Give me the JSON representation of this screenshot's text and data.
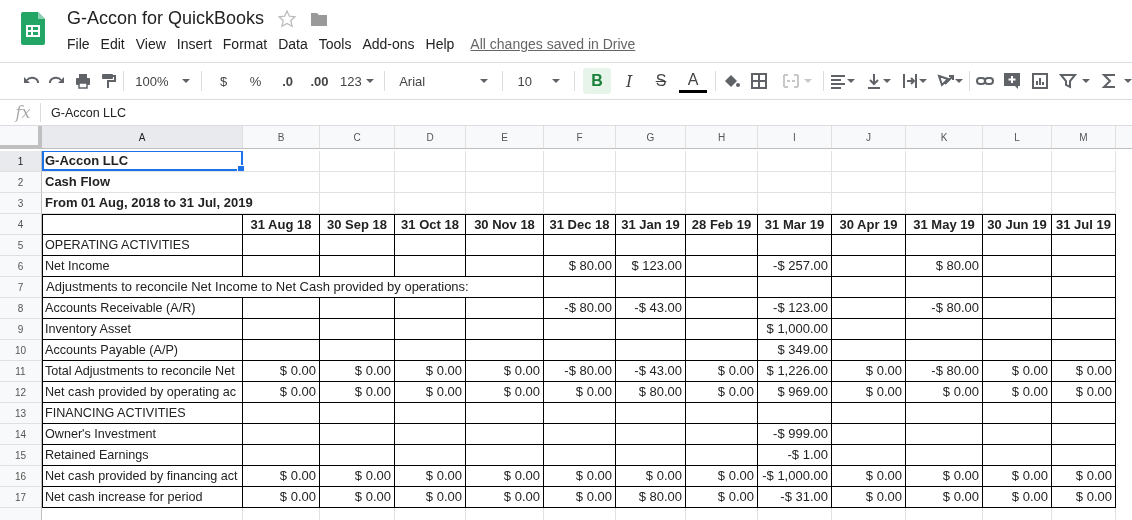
{
  "document": {
    "title": "G-Accon for QuickBooks",
    "starred": false,
    "save_status": "All changes saved in Drive"
  },
  "menu": [
    "File",
    "Edit",
    "View",
    "Insert",
    "Format",
    "Data",
    "Tools",
    "Add-ons",
    "Help"
  ],
  "toolbar": {
    "zoom": "100%",
    "currency": "$",
    "percent": "%",
    "decrease_decimals": ".0",
    "increase_decimals": ".00",
    "more_formats": "123",
    "font": "Arial",
    "font_size": "10",
    "styles": [
      {
        "kind": "bold",
        "label": "B",
        "selected": true
      },
      {
        "kind": "italic",
        "label": "I",
        "selected": false
      },
      {
        "kind": "strike",
        "label": "S",
        "selected": false
      },
      {
        "kind": "color",
        "label": "A",
        "selected": false
      }
    ],
    "merge": {
      "disabled": true
    }
  },
  "formula_bar": {
    "label": "fx",
    "value": "G-Accon LLC"
  },
  "columns": [
    {
      "name": "A",
      "selected": true
    },
    {
      "name": "B",
      "selected": false
    },
    {
      "name": "C",
      "selected": false
    },
    {
      "name": "D",
      "selected": false
    },
    {
      "name": "E",
      "selected": false
    },
    {
      "name": "F",
      "selected": false
    },
    {
      "name": "G",
      "selected": false
    },
    {
      "name": "H",
      "selected": false
    },
    {
      "name": "I",
      "selected": false
    },
    {
      "name": "J",
      "selected": false
    },
    {
      "name": "K",
      "selected": false
    },
    {
      "name": "L",
      "selected": false
    },
    {
      "name": "M",
      "selected": false
    }
  ],
  "rows": [
    {
      "number": "1",
      "kind": "title",
      "selected": true,
      "cells": {
        "A": "G-Accon LLC"
      }
    },
    {
      "number": "2",
      "kind": "title",
      "selected": false,
      "cells": {
        "A": "Cash Flow"
      }
    },
    {
      "number": "3",
      "kind": "title",
      "selected": false,
      "cells": {
        "A": "From 01 Aug, 2018 to 31 Jul, 2019"
      }
    },
    {
      "number": "4",
      "kind": "header",
      "selected": false,
      "cells": {
        "B": "31 Aug 18",
        "C": "30 Sep 18",
        "D": "31 Oct 18",
        "E": "30 Nov 18",
        "F": "31 Dec 18",
        "G": "31 Jan 19",
        "H": "28 Feb 19",
        "I": "31 Mar 19",
        "J": "30 Apr 19",
        "K": "31 May 19",
        "L": "30 Jun 19",
        "M": "31 Jul 19"
      }
    },
    {
      "number": "5",
      "kind": "data",
      "selected": false,
      "cells": {
        "A": "OPERATING ACTIVITIES"
      }
    },
    {
      "number": "6",
      "kind": "data",
      "selected": false,
      "cells": {
        "A": "Net Income",
        "F": "$ 80.00",
        "G": "$ 123.00",
        "I": "-$ 257.00",
        "K": "$ 80.00"
      }
    },
    {
      "number": "7",
      "kind": "note",
      "selected": false,
      "cells": {
        "A": "Adjustments to reconcile Net Income to Net Cash provided by operations:"
      }
    },
    {
      "number": "8",
      "kind": "data",
      "selected": false,
      "cells": {
        "A": "Accounts Receivable (A/R)",
        "F": "-$ 80.00",
        "G": "-$ 43.00",
        "I": "-$ 123.00",
        "K": "-$ 80.00"
      }
    },
    {
      "number": "9",
      "kind": "data",
      "selected": false,
      "cells": {
        "A": "Inventory Asset",
        "I": "$ 1,000.00"
      }
    },
    {
      "number": "10",
      "kind": "data",
      "selected": false,
      "cells": {
        "A": "Accounts Payable (A/P)",
        "I": "$ 349.00"
      }
    },
    {
      "number": "11",
      "kind": "data",
      "selected": false,
      "cells": {
        "A": "Total Adjustments to reconcile Net",
        "B": "$ 0.00",
        "C": "$ 0.00",
        "D": "$ 0.00",
        "E": "$ 0.00",
        "F": "-$ 80.00",
        "G": "-$ 43.00",
        "H": "$ 0.00",
        "I": "$ 1,226.00",
        "J": "$ 0.00",
        "K": "-$ 80.00",
        "L": "$ 0.00",
        "M": "$ 0.00"
      }
    },
    {
      "number": "12",
      "kind": "data",
      "selected": false,
      "cells": {
        "A": "Net cash provided by operating ac",
        "B": "$ 0.00",
        "C": "$ 0.00",
        "D": "$ 0.00",
        "E": "$ 0.00",
        "F": "$ 0.00",
        "G": "$ 80.00",
        "H": "$ 0.00",
        "I": "$ 969.00",
        "J": "$ 0.00",
        "K": "$ 0.00",
        "L": "$ 0.00",
        "M": "$ 0.00"
      }
    },
    {
      "number": "13",
      "kind": "data",
      "selected": false,
      "cells": {
        "A": "FINANCING ACTIVITIES"
      }
    },
    {
      "number": "14",
      "kind": "data",
      "selected": false,
      "cells": {
        "A": "Owner's Investment",
        "I": "-$ 999.00"
      }
    },
    {
      "number": "15",
      "kind": "data",
      "selected": false,
      "cells": {
        "A": "Retained Earnings",
        "I": "-$ 1.00"
      }
    },
    {
      "number": "16",
      "kind": "data",
      "selected": false,
      "cells": {
        "A": "Net cash provided by financing act",
        "B": "$ 0.00",
        "C": "$ 0.00",
        "D": "$ 0.00",
        "E": "$ 0.00",
        "F": "$ 0.00",
        "G": "$ 0.00",
        "H": "$ 0.00",
        "I": "-$ 1,000.00",
        "J": "$ 0.00",
        "K": "$ 0.00",
        "L": "$ 0.00",
        "M": "$ 0.00"
      }
    },
    {
      "number": "17",
      "kind": "data",
      "selected": false,
      "cells": {
        "A": "Net cash increase for period",
        "B": "$ 0.00",
        "C": "$ 0.00",
        "D": "$ 0.00",
        "E": "$ 0.00",
        "F": "$ 0.00",
        "G": "$ 80.00",
        "H": "$ 0.00",
        "I": "-$ 31.00",
        "J": "$ 0.00",
        "K": "$ 0.00",
        "L": "$ 0.00",
        "M": "$ 0.00"
      }
    },
    {
      "kind": "blank",
      "selected": false
    }
  ]
}
